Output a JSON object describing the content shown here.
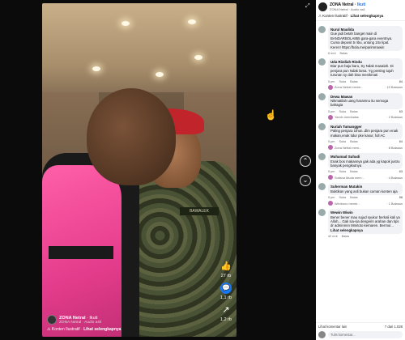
{
  "video": {
    "channel_name": "ZONA Netral",
    "follow_label": "Ikuti",
    "channel_sub": "ZONA Netral · Audio asli",
    "warning": "Konten Ilustratif ·",
    "warning_link": "Lihat selengkapnya",
    "badge_text": "BAWALEK",
    "likes": "27 rb",
    "comments": "1,1 rb",
    "shares": "1,2 rb"
  },
  "panel": {
    "channel_name": "ZONA Netral",
    "follow_label": "Ikuti",
    "channel_sub": "ZONA Netral · Audio asli",
    "warning": "Konten Ilustratif ·",
    "warning_link": "Lihat selengkapnya",
    "comments": [
      {
        "author": "Nurul Maulida",
        "text": "Gue jadi betah banget main di BANDARBOLA855 gara-gara eventnya. Cuma deposit 5 ribu, untung 10x lipat. Keren! https://bola.me/parimmawin",
        "meta": "6 mnt",
        "reply": "Balas",
        "react": ""
      },
      {
        "author": "Uda Rizdiah Rindu",
        "text": "Biar pun baju baru, Sy Ndak masalah. Di penjara pun Ndak lama. Yg penting tujuh turunan sy dah bisa menikmati",
        "meta": "5 pm",
        "reply": "Balas",
        "react_label": "Suka",
        "react": "84",
        "replies_author": "Zona Netral meme...",
        "replies_count": "· 19 Balasan"
      },
      {
        "author": "Dewa Mawan",
        "text": "Nikmatilah uang haramnu itu semoga bahagia",
        "meta": "5 pm",
        "reply": "Balas",
        "react_label": "Suka",
        "react": "63",
        "replies_author": "Yamin membalas",
        "replies_count": "· 2 Balasan"
      },
      {
        "author": "Nuriah Tumangger",
        "text": "Paling penjara 1thun..dlm penjara pun enak makan,enak tidur pke kasur, full AC",
        "meta": "5 pm",
        "reply": "Balas",
        "react_label": "Suka",
        "react": "64",
        "replies_author": "Zona Netral mem...",
        "replies_count": "· 8 Balasan"
      },
      {
        "author": "Muhamad Suhadi",
        "text": "Enak bos makannya gak ada yg kapok justru banyak pengikutnya",
        "meta": "5 pm",
        "reply": "Balas",
        "react_label": "Suka",
        "react": "63",
        "replies_author": "Sutisna Muda mem...",
        "replies_count": "· 4 Balasan"
      },
      {
        "author": "Suherman Mutakin",
        "text": "Buktikan yang asli bukan cuman konten aja",
        "meta": "5 pm",
        "reply": "Balas",
        "react_label": "Suka",
        "react": "58",
        "replies_author": "Wimbono memb...",
        "replies_count": "· 1 Balasan"
      },
      {
        "author": "Wewin Wiwin",
        "text": "Bener bener mau sujud syukur berkali kali ya Alloh... Gak sia-sia dengerin arahan dan tips dr adminnnn Mmitoto kemaren. Bermul...",
        "see_more": "Lihat selengkapnya",
        "meta": "42 mnt",
        "reply": "Balas",
        "react": ""
      }
    ],
    "footer_more": "Lihat komentar lain",
    "footer_count": "7 dari 1.028",
    "input_placeholder": "Tulis komentar..."
  }
}
